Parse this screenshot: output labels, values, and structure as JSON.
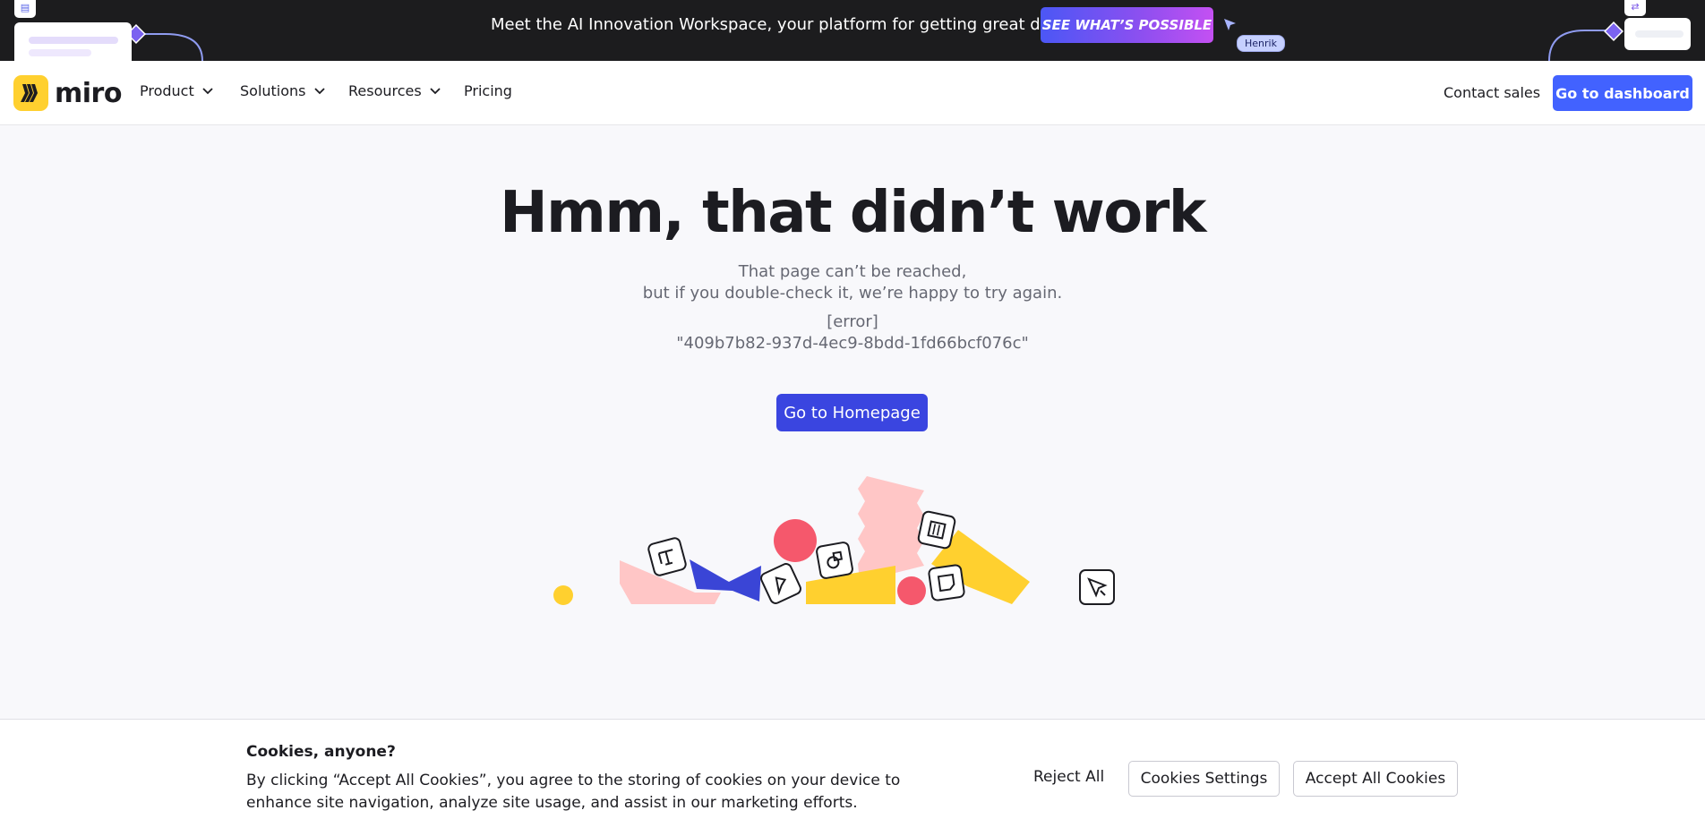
{
  "banner": {
    "text": "Meet the AI Innovation Workspace, your platform for getting great done.",
    "cta_label": "SEE WHAT’S POSSIBLE",
    "cursor_name": "Henrik"
  },
  "nav": {
    "logo_text": "miro",
    "items": [
      {
        "label": "Product"
      },
      {
        "label": "Solutions"
      },
      {
        "label": "Resources"
      },
      {
        "label": "Pricing"
      }
    ],
    "contact_label": "Contact sales",
    "dashboard_label": "Go to dashboard"
  },
  "main": {
    "headline": "Hmm, that didn’t work",
    "subtext_line1": "That page can’t be reached,",
    "subtext_line2": "but if you double-check it, we’re happy to try again.",
    "error_label": "[error]",
    "error_id": "\"409b7b82-937d-4ec9-8bdd-1fd66bcf076c\"",
    "home_button": "Go to Homepage"
  },
  "cookies": {
    "title": "Cookies, anyone?",
    "body": "By clicking “Accept All Cookies”, you agree to the storing of cookies on your device to enhance site navigation, analyze site usage, and assist in our marketing efforts.",
    "reject_label": "Reject All",
    "settings_label": "Cookies Settings",
    "accept_label": "Accept All Cookies"
  },
  "colors": {
    "brand_yellow": "#ffd02f",
    "primary_blue": "#4262ff",
    "banner_bg": "#1c1c1e"
  }
}
